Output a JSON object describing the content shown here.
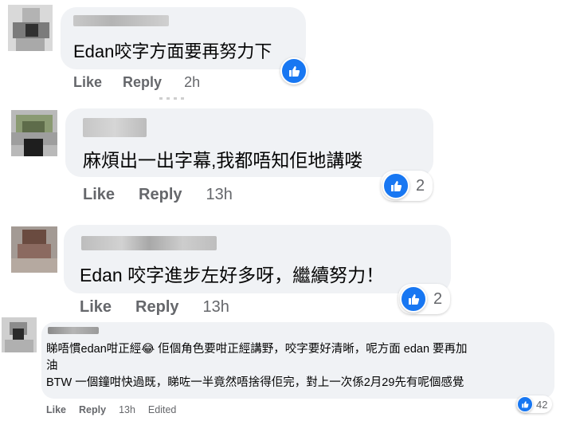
{
  "comments": [
    {
      "text": "Edan咬字方面要再努力下",
      "like_label": "Like",
      "reply_label": "Reply",
      "time": "2h",
      "reaction_count": "",
      "reaction_icon": "thumbs-up-icon"
    },
    {
      "text": "麻煩出一出字幕,我都唔知佢地講喽",
      "like_label": "Like",
      "reply_label": "Reply",
      "time": "13h",
      "reaction_count": "2",
      "reaction_icon": "thumbs-up-icon"
    },
    {
      "text": "Edan 咬字進步左好多呀，繼續努力！",
      "like_label": "Like",
      "reply_label": "Reply",
      "time": "13h",
      "reaction_count": "2",
      "reaction_icon": "thumbs-up-icon"
    },
    {
      "text_line1": "睇唔慣edan咁正經😂 佢個角色要咁正經講野，咬字要好清晰，呢方面 edan 要再加",
      "text_line2": "油",
      "text_line3": "BTW 一個鐘咁快過既，睇咗一半竟然唔捨得佢完，對上一次係2月29先有呢個感覺",
      "like_label": "Like",
      "reply_label": "Reply",
      "time": "13h",
      "edited_label": "Edited",
      "reaction_count": "42",
      "reaction_icon": "thumbs-up-icon"
    }
  ],
  "colors": {
    "bubble": "#f0f2f5",
    "like_blue": "#1877f2",
    "meta_text": "#65676b"
  }
}
